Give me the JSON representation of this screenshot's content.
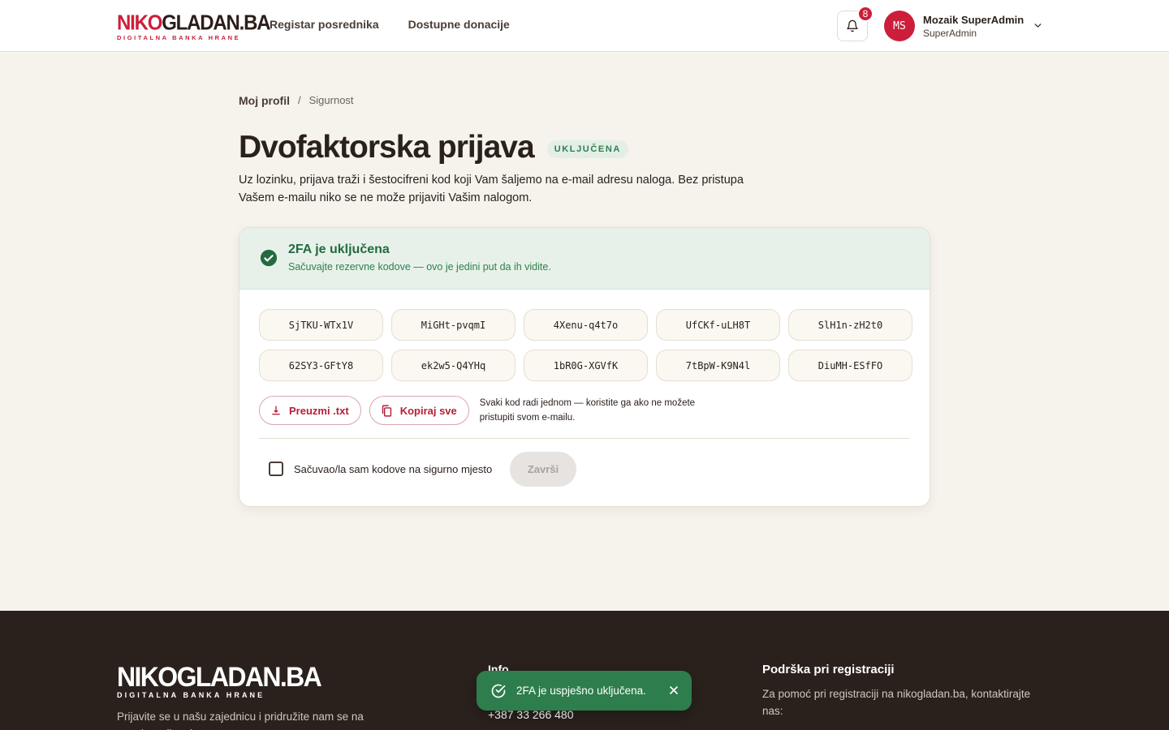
{
  "header": {
    "logo_part1": "NIKO",
    "logo_part2": "GLADAN.BA",
    "logo_tagline": "DIGITALNA BANKA HRANE",
    "nav": [
      {
        "label": "Registar posrednika"
      },
      {
        "label": "Dostupne donacije"
      }
    ],
    "notifications_count": "8",
    "user": {
      "initials": "MS",
      "name": "Mozaik SuperAdmin",
      "role": "SuperAdmin"
    }
  },
  "breadcrumb": {
    "parent": "Moj profil",
    "separator": "/",
    "current": "Sigurnost"
  },
  "page": {
    "title": "Dvofaktorska prijava",
    "status": "UKLJUČENA",
    "description": "Uz lozinku, prijava traži i šestocifreni kod koji Vam šaljemo na e-mail adresu naloga. Bez pristupa Vašem e-mailu niko se ne može prijaviti Vašim nalogom."
  },
  "card": {
    "banner_title": "2FA je uključena",
    "banner_subtitle": "Sačuvajte rezervne kodove — ovo je jedini put da ih vidite.",
    "codes": [
      "SjTKU-WTx1V",
      "MiGHt-pvqmI",
      "4Xenu-q4t7o",
      "UfCKf-uLH8T",
      "SlH1n-zH2t0",
      "62SY3-GFtY8",
      "ek2w5-Q4YHq",
      "1bR0G-XGVfK",
      "7tBpW-K9N4l",
      "DiuMH-ESfFO"
    ],
    "download_label": "Preuzmi .txt",
    "copy_label": "Kopiraj sve",
    "hint": "Svaki kod radi jednom — koristite ga ako ne možete pristupiti svom e-mailu.",
    "confirm_label": "Sačuvao/la sam kodove na sigurno mjesto",
    "finish_label": "Završi"
  },
  "footer": {
    "logo": "NIKOGLADAN.BA",
    "logo_tagline": "DIGITALNA BANKA HRANE",
    "join_text": "Prijavite se u našu zajednicu i pridružite nam se na putu ka svijetu bez",
    "info_title": "Info",
    "phone": "+387 33 266 480",
    "support_title": "Podrška pri registraciji",
    "support_text": "Za pomoć pri registraciji na nikogladan.ba, kontaktirajte nas:"
  },
  "toast": {
    "message": "2FA je uspješno uključena."
  },
  "colors": {
    "brand": "#cc1e3a",
    "success": "#2e7d4c",
    "background": "#f6f2ec",
    "footer": "#2a211d"
  }
}
